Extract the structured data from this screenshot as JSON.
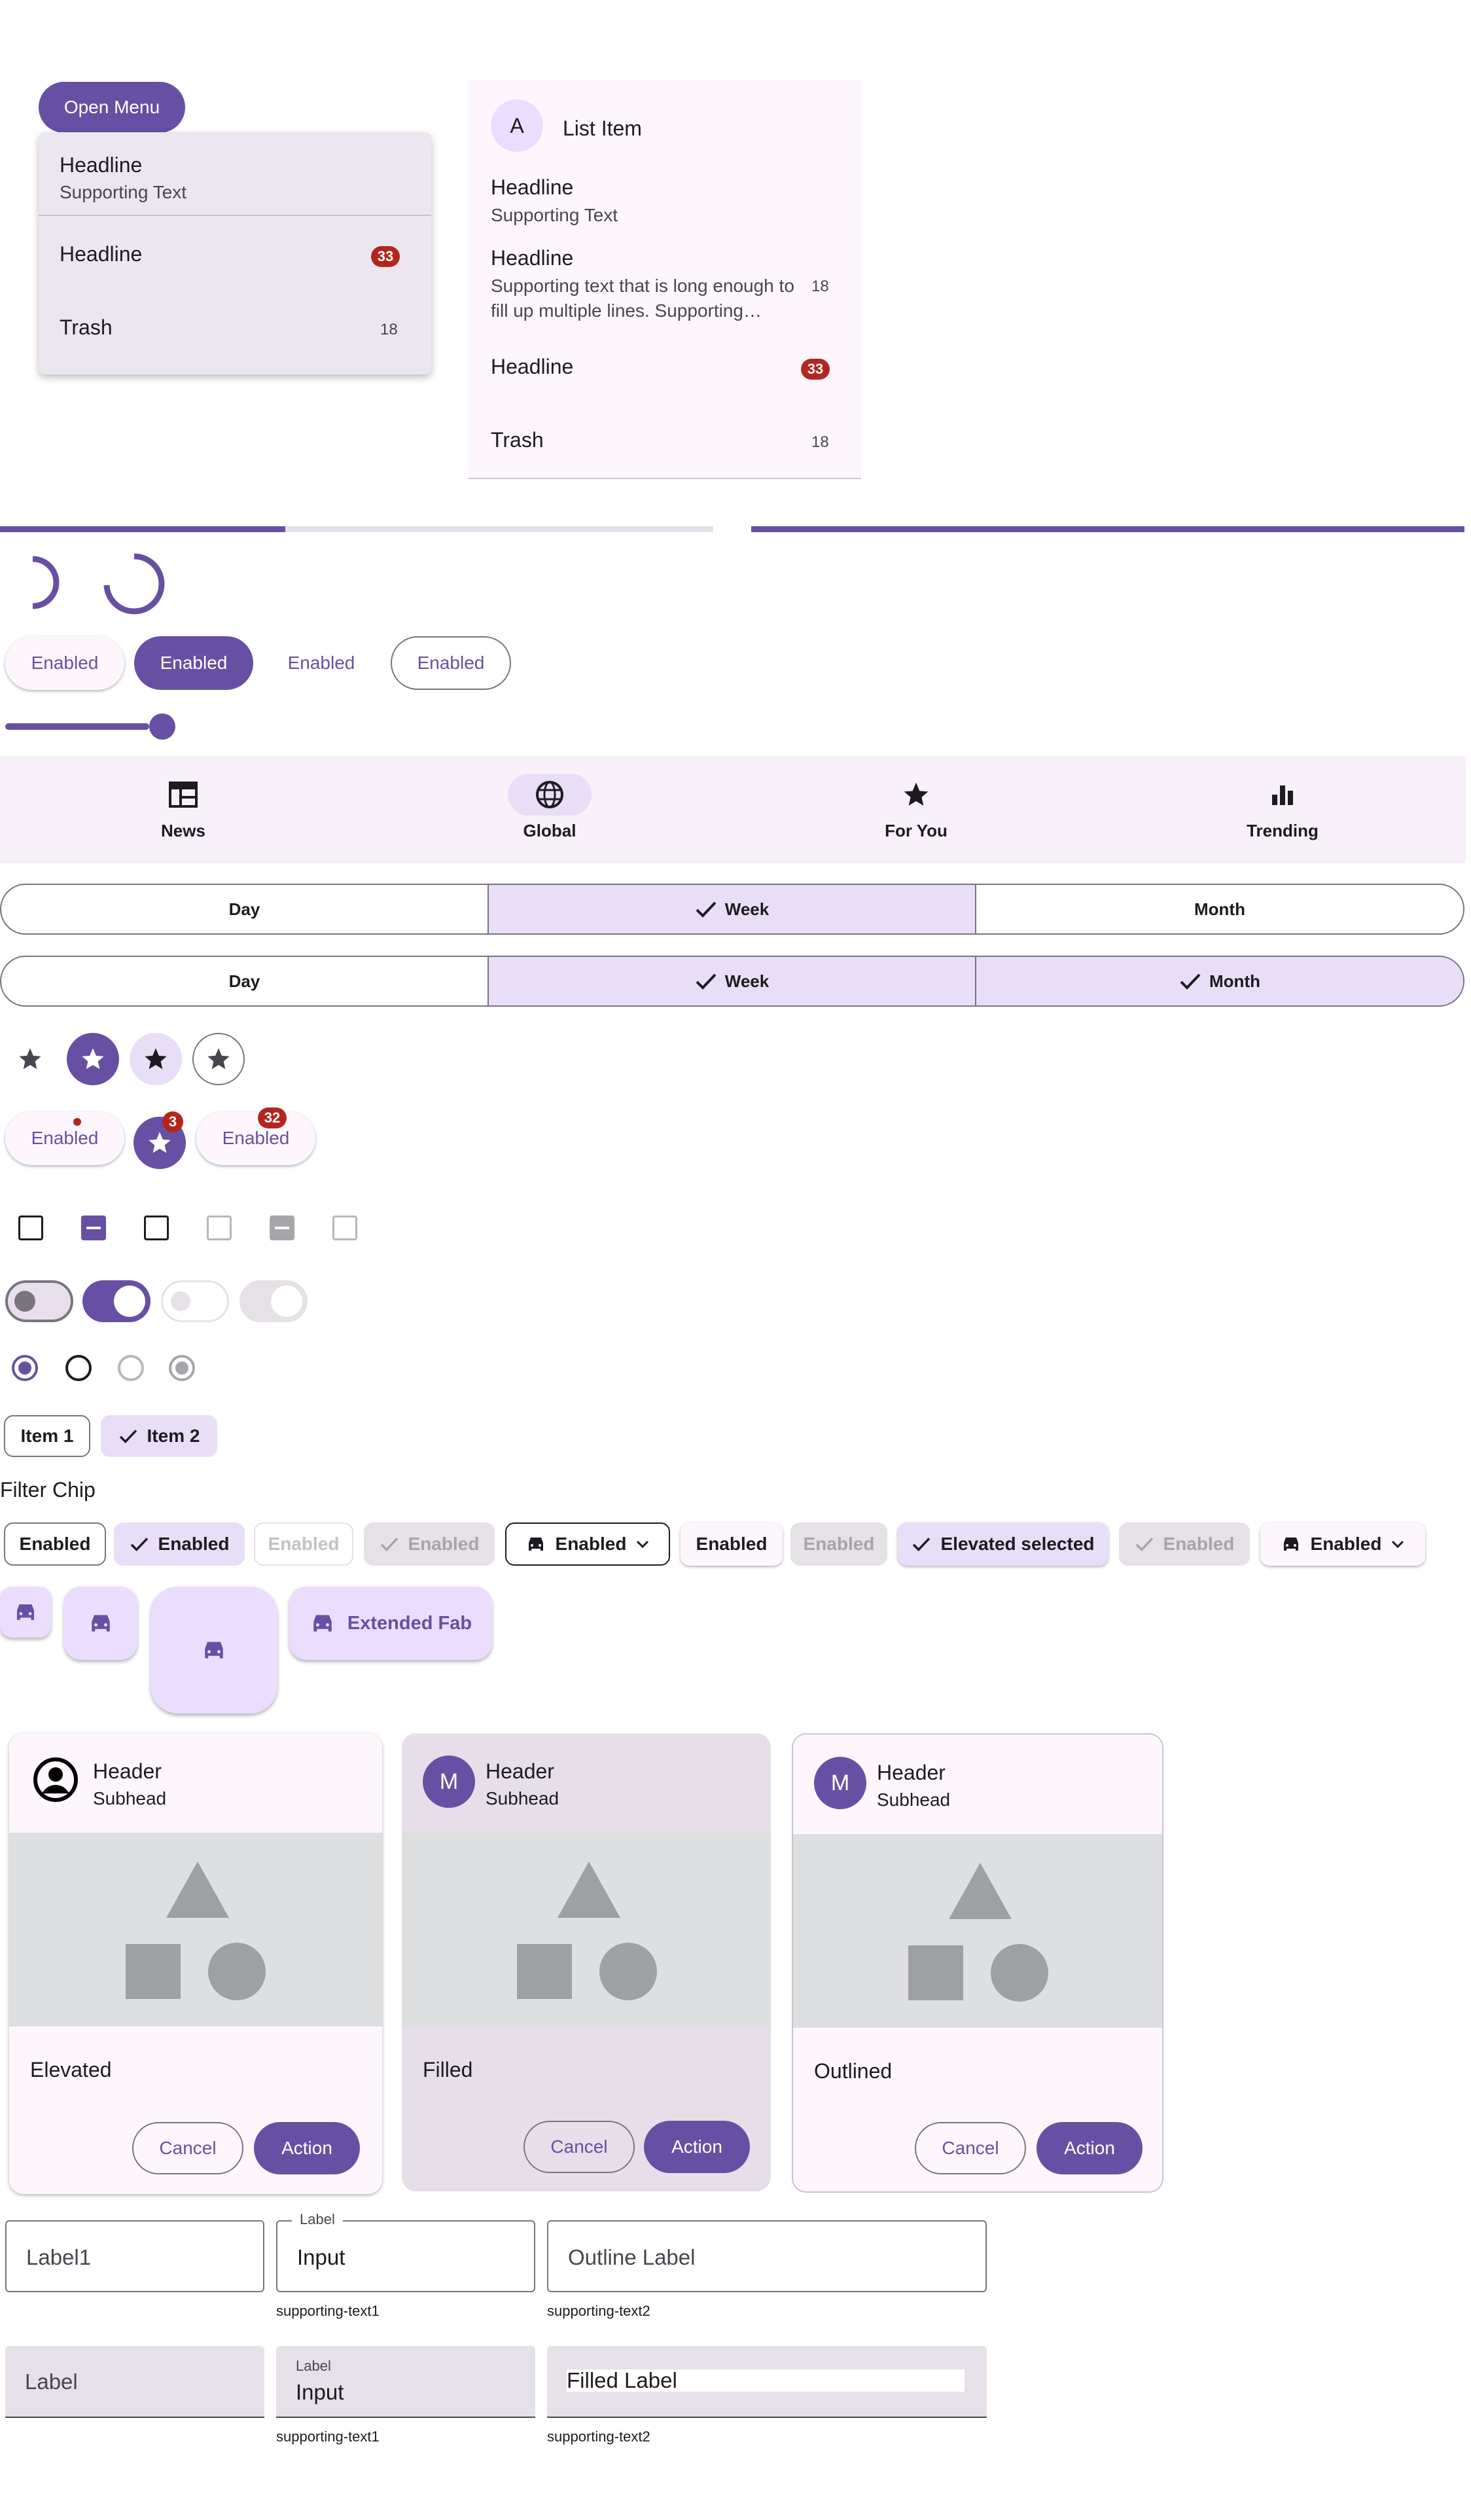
{
  "menu": {
    "open_button": "Open Menu",
    "items": [
      {
        "headline": "Headline",
        "supporting": "Supporting Text"
      },
      {
        "headline": "Headline",
        "badge": "33"
      },
      {
        "headline": "Trash",
        "count": "18"
      }
    ]
  },
  "list": {
    "avatar_letter": "A",
    "title": "List Item",
    "items": [
      {
        "headline": "Headline",
        "supporting": "Supporting Text"
      },
      {
        "headline": "Headline",
        "supporting": "Supporting text that is long enough to fill up multiple lines. Supporting…",
        "count": "18"
      },
      {
        "headline": "Headline",
        "badge": "33"
      },
      {
        "headline": "Trash",
        "count": "18"
      }
    ]
  },
  "progress": {
    "linear_value": 0.4
  },
  "buttons": [
    "Enabled",
    "Enabled",
    "Enabled",
    "Enabled"
  ],
  "slider": {
    "value": 1.0
  },
  "navbar": {
    "items": [
      {
        "label": "News",
        "icon": "newspaper-icon"
      },
      {
        "label": "Global",
        "icon": "globe-icon",
        "active": true
      },
      {
        "label": "For You",
        "icon": "star-icon"
      },
      {
        "label": "Trending",
        "icon": "bar-chart-icon"
      }
    ]
  },
  "segmented_single": [
    "Day",
    "Week",
    "Month"
  ],
  "segmented_multi": [
    "Day",
    "Week",
    "Month"
  ],
  "badged": {
    "chip1": "Enabled",
    "fab_badge": "3",
    "chip2": "Enabled",
    "chip2_badge": "32"
  },
  "chips_input": [
    "Item 1",
    "Item 2"
  ],
  "filter_title": "Filter Chip",
  "filter_chips": [
    "Enabled",
    "Enabled",
    "Enabled",
    "Enabled",
    "Enabled",
    "Enabled",
    "Enabled",
    "Elevated selected",
    "Enabled",
    "Enabled"
  ],
  "fab": {
    "extended_label": "Extended Fab"
  },
  "cards": [
    {
      "header": "Header",
      "subhead": "Subhead",
      "body": "Elevated",
      "cancel": "Cancel",
      "action": "Action"
    },
    {
      "header": "Header",
      "subhead": "Subhead",
      "avatar": "M",
      "body": "Filled",
      "cancel": "Cancel",
      "action": "Action"
    },
    {
      "header": "Header",
      "subhead": "Subhead",
      "avatar": "M",
      "body": "Outlined",
      "cancel": "Cancel",
      "action": "Action"
    }
  ],
  "outlined_fields": [
    {
      "placeholder": "Label1"
    },
    {
      "label": "Label",
      "value": "Input",
      "supporting": "supporting-text1"
    },
    {
      "placeholder": "Outline Label",
      "supporting": "supporting-text2"
    }
  ],
  "filled_fields": [
    {
      "placeholder": "Label"
    },
    {
      "label": "Label",
      "value": "Input",
      "supporting": "supporting-text1"
    },
    {
      "placeholder": "Filled Label",
      "supporting": "supporting-text2"
    }
  ]
}
